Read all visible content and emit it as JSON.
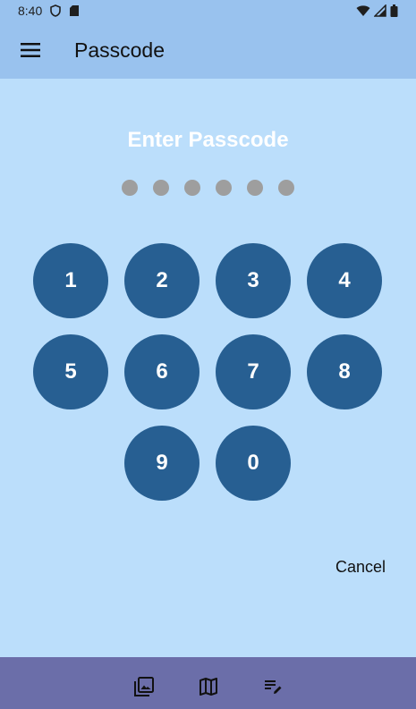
{
  "status_bar": {
    "time": "8:40"
  },
  "app_bar": {
    "title": "Passcode",
    "menu_icon": "hamburger-menu-icon"
  },
  "prompt": {
    "text": "Enter Passcode",
    "digits_total": 6,
    "digits_entered": 0
  },
  "keypad": {
    "keys": [
      "1",
      "2",
      "3",
      "4",
      "5",
      "6",
      "7",
      "8",
      "9",
      "0"
    ]
  },
  "cancel_label": "Cancel",
  "bottom_nav": {
    "items": [
      "gallery-icon",
      "map-icon",
      "edit-list-icon"
    ]
  },
  "colors": {
    "background": "#bbdefb",
    "app_bar": "#99c2ee",
    "key": "#275f92",
    "dot": "#9e9e9e",
    "bottom_bar": "#6b6ea9"
  }
}
